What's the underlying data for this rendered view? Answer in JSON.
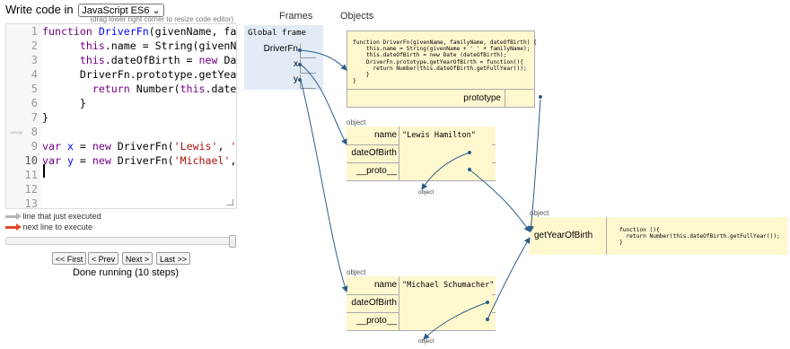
{
  "editor": {
    "label": "Write code in",
    "language": "JavaScript ES6",
    "resize_hint": "(drag lower right corner to resize code editor)",
    "line_numbers": [
      "1",
      "2",
      "3",
      "4",
      "5",
      "6",
      "7",
      "8",
      "9",
      "10",
      "11",
      "12",
      "13"
    ],
    "current_line": "10"
  },
  "legend": {
    "executed": "line that just executed",
    "next": "next line to execute"
  },
  "nav": {
    "first": "<< First",
    "prev": "< Prev",
    "next": "Next >",
    "last": "Last >>",
    "status": "Done running (10 steps)"
  },
  "viz": {
    "frames_header": "Frames",
    "objects_header": "Objects",
    "global_frame_title": "Global frame",
    "global_vars": [
      "DriverFn",
      "x",
      "y"
    ],
    "fn_object": {
      "code": "function DriverFn(givenName, familyName, dateOfBirth) {\n    this.name = String(givenName + ' ' + familyName);\n    this.dateOfBirth = new Date (dateOfBirth);\n    DriverFn.prototype.getYearOfBirth = function(){\n      return Number(this.dateOfBirth.getFullYear());\n    }\n}",
      "prototype_label": "prototype"
    },
    "obj_label": "object",
    "obj_x": {
      "name_key": "name",
      "name_val": "\"Lewis Hamilton\"",
      "dob_key": "dateOfBirth",
      "proto_key": "__proto__"
    },
    "obj_y": {
      "name_key": "name",
      "name_val": "\"Michael Schumacher\"",
      "dob_key": "dateOfBirth",
      "proto_key": "__proto__"
    },
    "small_object_label": "object",
    "proto_obj": {
      "key": "getYearOfBirth",
      "code": "function (){\n  return Number(this.dateOfBirth.getFullYear());\n}"
    }
  },
  "colors": {
    "pointer": "#2c5d8a",
    "next_arrow": "#e04a2a",
    "exec_arrow": "#b5b5b5"
  }
}
